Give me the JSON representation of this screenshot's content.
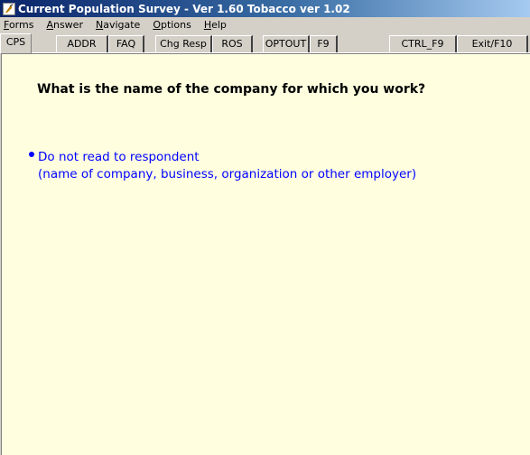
{
  "window": {
    "title": "Current Population Survey - Ver 1.60 Tobacco ver 1.02"
  },
  "menu": {
    "items": [
      {
        "label": "Forms",
        "ul": "F",
        "rest": "orms"
      },
      {
        "label": "Answer",
        "ul": "A",
        "rest": "nswer"
      },
      {
        "label": "Navigate",
        "ul": "N",
        "rest": "avigate"
      },
      {
        "label": "Options",
        "ul": "O",
        "rest": "ptions"
      },
      {
        "label": "Help",
        "ul": "H",
        "rest": "elp"
      }
    ]
  },
  "tabs": [
    {
      "label": "CPS",
      "active": true
    },
    {
      "label": "ADDR"
    },
    {
      "label": "FAQ"
    },
    {
      "label": "Chg Resp"
    },
    {
      "label": "ROS"
    },
    {
      "label": "OPTOUT"
    },
    {
      "label": "F9"
    },
    {
      "label": "CTRL_F9"
    },
    {
      "label": "Exit/F10"
    }
  ],
  "question": {
    "text": "What is the name of the company for which you work?"
  },
  "instruction": {
    "line1": "Do not read to respondent",
    "line2": "(name of company, business, organization or other employer)"
  },
  "colors": {
    "content_bg": "#ffffe0",
    "instruction_text": "#0000ff",
    "titlebar_start": "#0a246a"
  },
  "icons": {
    "app": "survey-app-icon",
    "bullet": "bullet-dot-icon"
  }
}
